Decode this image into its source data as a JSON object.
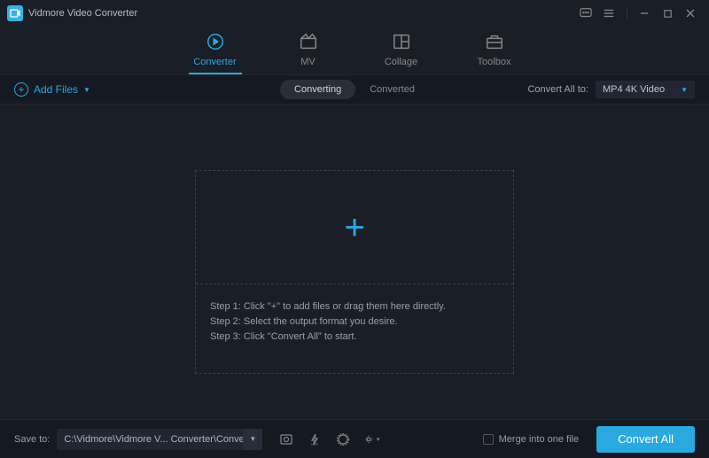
{
  "app": {
    "title": "Vidmore Video Converter"
  },
  "tabs": {
    "items": [
      {
        "label": "Converter"
      },
      {
        "label": "MV"
      },
      {
        "label": "Collage"
      },
      {
        "label": "Toolbox"
      }
    ]
  },
  "subbar": {
    "add_files": "Add Files",
    "converting": "Converting",
    "converted": "Converted",
    "convert_all_to_label": "Convert All to:",
    "format_value": "MP4 4K Video"
  },
  "dropzone": {
    "step1": "Step 1: Click \"+\" to add files or drag them here directly.",
    "step2": "Step 2: Select the output format you desire.",
    "step3": "Step 3: Click \"Convert All\" to start."
  },
  "footer": {
    "save_to_label": "Save to:",
    "path": "C:\\Vidmore\\Vidmore V... Converter\\Converted",
    "merge_label": "Merge into one file",
    "convert_all": "Convert All"
  }
}
